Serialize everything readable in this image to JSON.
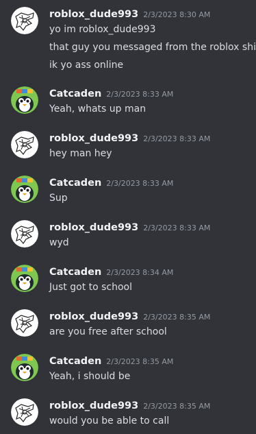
{
  "users": {
    "roblox": {
      "name": "roblox_dude993",
      "avatar_icon": "sketch-avatar-icon"
    },
    "cat": {
      "name": "Catcaden",
      "avatar_icon": "penguin-avatar-icon"
    }
  },
  "colors": {
    "background": "#313338",
    "username": "#f2f3f5",
    "timestamp": "#949ba4",
    "message_text": "#dbdee1"
  },
  "messages": [
    {
      "author": "roblox_dude993",
      "timestamp": "2/3/2023 8:30 AM",
      "lines": [
        "yo im roblox_dude993",
        "that guy you messaged from the roblox shit",
        "ik yo ass online"
      ]
    },
    {
      "author": "Catcaden",
      "timestamp": "2/3/2023 8:33 AM",
      "lines": [
        "Yeah, whats up man"
      ]
    },
    {
      "author": "roblox_dude993",
      "timestamp": "2/3/2023 8:33 AM",
      "lines": [
        "hey man hey"
      ]
    },
    {
      "author": "Catcaden",
      "timestamp": "2/3/2023 8:33 AM",
      "lines": [
        "Sup"
      ]
    },
    {
      "author": "roblox_dude993",
      "timestamp": "2/3/2023 8:33 AM",
      "lines": [
        "wyd"
      ]
    },
    {
      "author": "Catcaden",
      "timestamp": "2/3/2023 8:34 AM",
      "lines": [
        "Just got to school"
      ]
    },
    {
      "author": "roblox_dude993",
      "timestamp": "2/3/2023 8:35 AM",
      "lines": [
        "are you free after school"
      ]
    },
    {
      "author": "Catcaden",
      "timestamp": "2/3/2023 8:35 AM",
      "lines": [
        "Yeah, i should be"
      ]
    },
    {
      "author": "roblox_dude993",
      "timestamp": "2/3/2023 8:35 AM",
      "lines": [
        "would you be able to call"
      ]
    }
  ]
}
